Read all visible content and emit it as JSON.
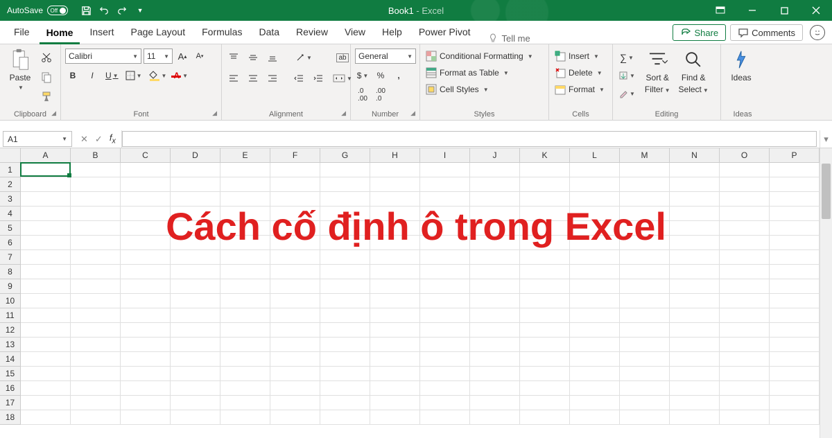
{
  "title_bar": {
    "autosave_label": "AutoSave",
    "autosave_state": "Off",
    "doc_name": "Book1",
    "app_suffix": " - Excel"
  },
  "tabs": {
    "items": [
      "File",
      "Home",
      "Insert",
      "Page Layout",
      "Formulas",
      "Data",
      "Review",
      "View",
      "Help",
      "Power Pivot"
    ],
    "active_index": 1,
    "tell_me": "Tell me",
    "share": "Share",
    "comments": "Comments"
  },
  "ribbon": {
    "clipboard": {
      "label": "Clipboard",
      "paste": "Paste"
    },
    "font": {
      "label": "Font",
      "name": "Calibri",
      "size": "11",
      "bold": "B",
      "italic": "I",
      "underline": "U"
    },
    "alignment": {
      "label": "Alignment"
    },
    "wrap": "ab",
    "number": {
      "label": "Number",
      "format": "General",
      "currency": "$",
      "percent": "%",
      "comma": ","
    },
    "styles": {
      "label": "Styles",
      "cond": "Conditional Formatting",
      "table": "Format as Table",
      "cell": "Cell Styles"
    },
    "cells": {
      "label": "Cells",
      "insert": "Insert",
      "delete": "Delete",
      "format": "Format"
    },
    "editing": {
      "label": "Editing",
      "sort": "Sort &",
      "sort2": "Filter",
      "find": "Find &",
      "find2": "Select"
    },
    "ideas": {
      "label": "Ideas",
      "btn": "Ideas"
    }
  },
  "formula_bar": {
    "name_box": "A1",
    "formula": ""
  },
  "grid": {
    "columns": [
      "A",
      "B",
      "C",
      "D",
      "E",
      "F",
      "G",
      "H",
      "I",
      "J",
      "K",
      "L",
      "M",
      "N",
      "O",
      "P"
    ],
    "rows": [
      1,
      2,
      3,
      4,
      5,
      6,
      7,
      8,
      9,
      10,
      11,
      12,
      13,
      14,
      15,
      16,
      17,
      18
    ],
    "active": "A1"
  },
  "overlay": {
    "text": "Cách cố định ô trong Excel"
  }
}
